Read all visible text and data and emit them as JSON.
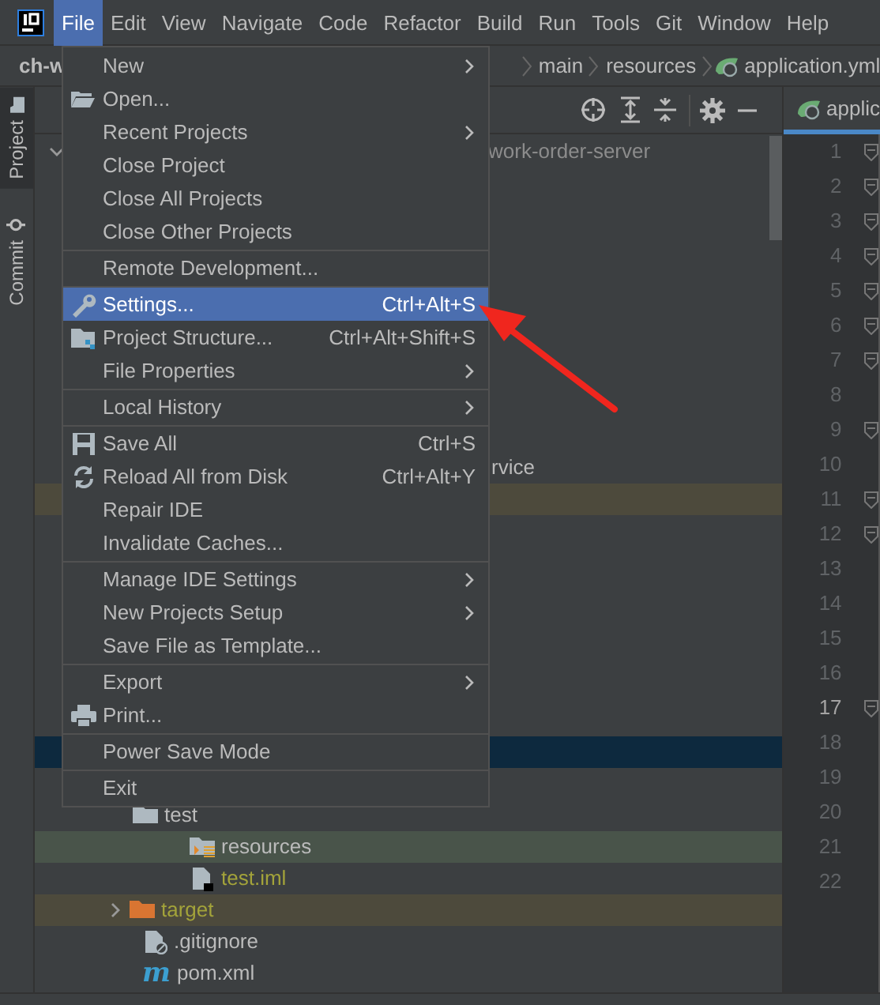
{
  "menubar": {
    "items": [
      {
        "label": "File",
        "selected": true
      },
      {
        "label": "Edit",
        "selected": false
      },
      {
        "label": "View",
        "selected": false
      },
      {
        "label": "Navigate",
        "selected": false
      },
      {
        "label": "Code",
        "selected": false
      },
      {
        "label": "Refactor",
        "selected": false
      },
      {
        "label": "Build",
        "selected": false
      },
      {
        "label": "Run",
        "selected": false
      },
      {
        "label": "Tools",
        "selected": false
      },
      {
        "label": "Git",
        "selected": false
      },
      {
        "label": "Window",
        "selected": false
      },
      {
        "label": "Help",
        "selected": false
      }
    ]
  },
  "breadcrumb": {
    "project": "ch-w",
    "path": [
      "main",
      "resources",
      "application.yml"
    ]
  },
  "side_tabs": [
    {
      "label": "Project",
      "selected": true,
      "kind": "folder"
    },
    {
      "label": "Commit",
      "selected": false,
      "kind": "commit"
    }
  ],
  "editor_tab": {
    "label": "applic"
  },
  "file_menu": [
    {
      "kind": "item",
      "label": "New",
      "submenu": true,
      "selected": false
    },
    {
      "kind": "item",
      "label": "Open...",
      "selected": false
    },
    {
      "kind": "item",
      "label": "Recent Projects",
      "submenu": true,
      "selected": false
    },
    {
      "kind": "item",
      "label": "Close Project",
      "selected": false
    },
    {
      "kind": "item",
      "label": "Close All Projects",
      "selected": false
    },
    {
      "kind": "item",
      "label": "Close Other Projects",
      "selected": false
    },
    {
      "kind": "separator"
    },
    {
      "kind": "item",
      "label": "Remote Development...",
      "selected": false
    },
    {
      "kind": "separator"
    },
    {
      "kind": "item",
      "label": "Settings...",
      "shortcut": "Ctrl+Alt+S",
      "selected": true
    },
    {
      "kind": "item",
      "label": "Project Structure...",
      "shortcut": "Ctrl+Alt+Shift+S",
      "selected": false
    },
    {
      "kind": "item",
      "label": "File Properties",
      "submenu": true,
      "selected": false
    },
    {
      "kind": "separator"
    },
    {
      "kind": "item",
      "label": "Local History",
      "submenu": true,
      "selected": false
    },
    {
      "kind": "separator"
    },
    {
      "kind": "item",
      "label": "Save All",
      "shortcut": "Ctrl+S",
      "selected": false
    },
    {
      "kind": "item",
      "label": "Reload All from Disk",
      "shortcut": "Ctrl+Alt+Y",
      "selected": false
    },
    {
      "kind": "item",
      "label": "Repair IDE",
      "selected": false
    },
    {
      "kind": "item",
      "label": "Invalidate Caches...",
      "selected": false
    },
    {
      "kind": "separator"
    },
    {
      "kind": "item",
      "label": "Manage IDE Settings",
      "submenu": true,
      "selected": false
    },
    {
      "kind": "item",
      "label": "New Projects Setup",
      "submenu": true,
      "selected": false
    },
    {
      "kind": "item",
      "label": "Save File as Template...",
      "selected": false
    },
    {
      "kind": "separator"
    },
    {
      "kind": "item",
      "label": "Export",
      "submenu": true,
      "selected": false
    },
    {
      "kind": "item",
      "label": "Print...",
      "selected": false
    },
    {
      "kind": "separator"
    },
    {
      "kind": "item",
      "label": "Power Save Mode",
      "selected": false
    },
    {
      "kind": "separator"
    },
    {
      "kind": "item",
      "label": "Exit",
      "selected": false
    }
  ],
  "tree": [
    {
      "text": "work-order-server",
      "color": "#8c8c8c",
      "selected": false,
      "excluded": false,
      "test_root": false,
      "expanded": true
    },
    {
      "text": "rvice",
      "color": "#bbbbbb",
      "selected": false,
      "excluded": false,
      "test_root": false
    },
    {
      "selected": false,
      "excluded": true,
      "test_root": false
    },
    {
      "selected": true,
      "excluded": false,
      "test_root": false
    },
    {
      "text": "test",
      "color": "#bbbbbb",
      "selected": false,
      "excluded": false,
      "test_root": false
    },
    {
      "text": "resources",
      "color": "#bbbbbb",
      "selected": false,
      "excluded": false,
      "test_root": true
    },
    {
      "text": "test.iml",
      "color": "#a3a33a",
      "selected": false,
      "excluded": false,
      "test_root": false
    },
    {
      "text": "target",
      "color": "#a3a33a",
      "selected": false,
      "excluded": true,
      "test_root": false,
      "expanded": false
    },
    {
      "text": ".gitignore",
      "color": "#bbbbbb",
      "selected": false,
      "excluded": false,
      "test_root": false
    },
    {
      "text": "pom.xml",
      "color": "#bbbbbb",
      "selected": false,
      "excluded": false,
      "test_root": false,
      "icon_text": "m"
    }
  ],
  "lines": [
    {
      "number": "1",
      "fold": true,
      "current": false
    },
    {
      "number": "2",
      "fold": true,
      "current": false
    },
    {
      "number": "3",
      "fold": true,
      "current": false
    },
    {
      "number": "4",
      "fold": true,
      "current": false
    },
    {
      "number": "5",
      "fold": true,
      "current": false
    },
    {
      "number": "6",
      "fold": true,
      "current": false
    },
    {
      "number": "7",
      "fold": true,
      "current": false
    },
    {
      "number": "8",
      "fold": false,
      "current": false
    },
    {
      "number": "9",
      "fold": true,
      "current": false
    },
    {
      "number": "10",
      "fold": false,
      "current": false
    },
    {
      "number": "11",
      "fold": true,
      "current": false
    },
    {
      "number": "12",
      "fold": true,
      "current": false
    },
    {
      "number": "13",
      "fold": false,
      "current": false
    },
    {
      "number": "14",
      "fold": false,
      "current": false
    },
    {
      "number": "15",
      "fold": false,
      "current": false
    },
    {
      "number": "16",
      "fold": false,
      "current": false
    },
    {
      "number": "17",
      "fold": true,
      "current": true
    },
    {
      "number": "18",
      "fold": false,
      "current": false
    },
    {
      "number": "19",
      "fold": false,
      "current": false
    },
    {
      "number": "20",
      "fold": false,
      "current": false
    },
    {
      "number": "21",
      "fold": false,
      "current": false
    },
    {
      "number": "22",
      "fold": false,
      "current": false
    }
  ]
}
